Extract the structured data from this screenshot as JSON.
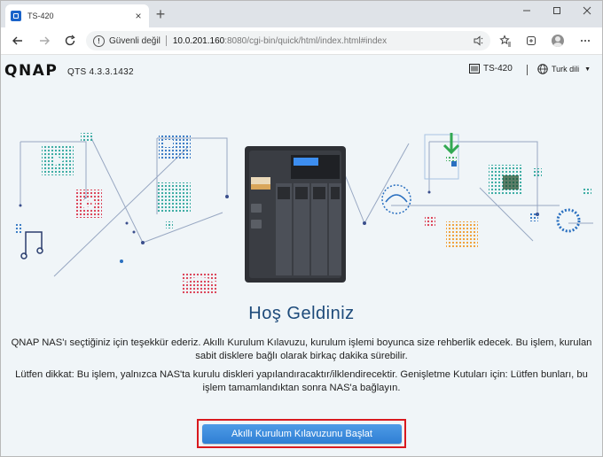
{
  "browser": {
    "tab_title": "TS-420",
    "tab_close": "×",
    "new_tab": "+",
    "security_label": "Güvenli değil",
    "url_host": "10.0.201.160",
    "url_rest": ":8080/cgi-bin/quick/html/index.html#index",
    "icons": {
      "back": "back-arrow-icon",
      "forward": "forward-arrow-icon",
      "reload": "reload-icon",
      "warning": "not-secure-icon",
      "minimize": "minimize-icon",
      "maximize": "maximize-icon",
      "close": "close-icon"
    }
  },
  "header": {
    "logo": "QNAP",
    "version": "QTS 4.3.3.1432",
    "device_name": "TS-420",
    "language": "Turk dili"
  },
  "main": {
    "title": "Hoş Geldiniz",
    "description_1": "QNAP NAS'ı seçtiğiniz için teşekkür ederiz. Akıllı Kurulum Kılavuzu, kurulum işlemi boyunca size rehberlik edecek. Bu işlem, kurulan sabit disklere bağlı olarak birkaç dakika sürebilir.",
    "description_2": "Lütfen dikkat: Bu işlem, yalnızca NAS'ta kurulu diskleri yapılandıracaktır/ilklendirecektir. Genişletme Kutuları için: Lütfen bunları, bu işlem tamamlandıktan sonra NAS'a bağlayın.",
    "start_button": "Akıllı Kurulum Kılavuzunu Başlat"
  },
  "colors": {
    "accent_button": "#2f7fd4",
    "title_blue": "#1d4a7a",
    "highlight_red": "#d9191e",
    "page_bg": "#f0f5f8"
  }
}
